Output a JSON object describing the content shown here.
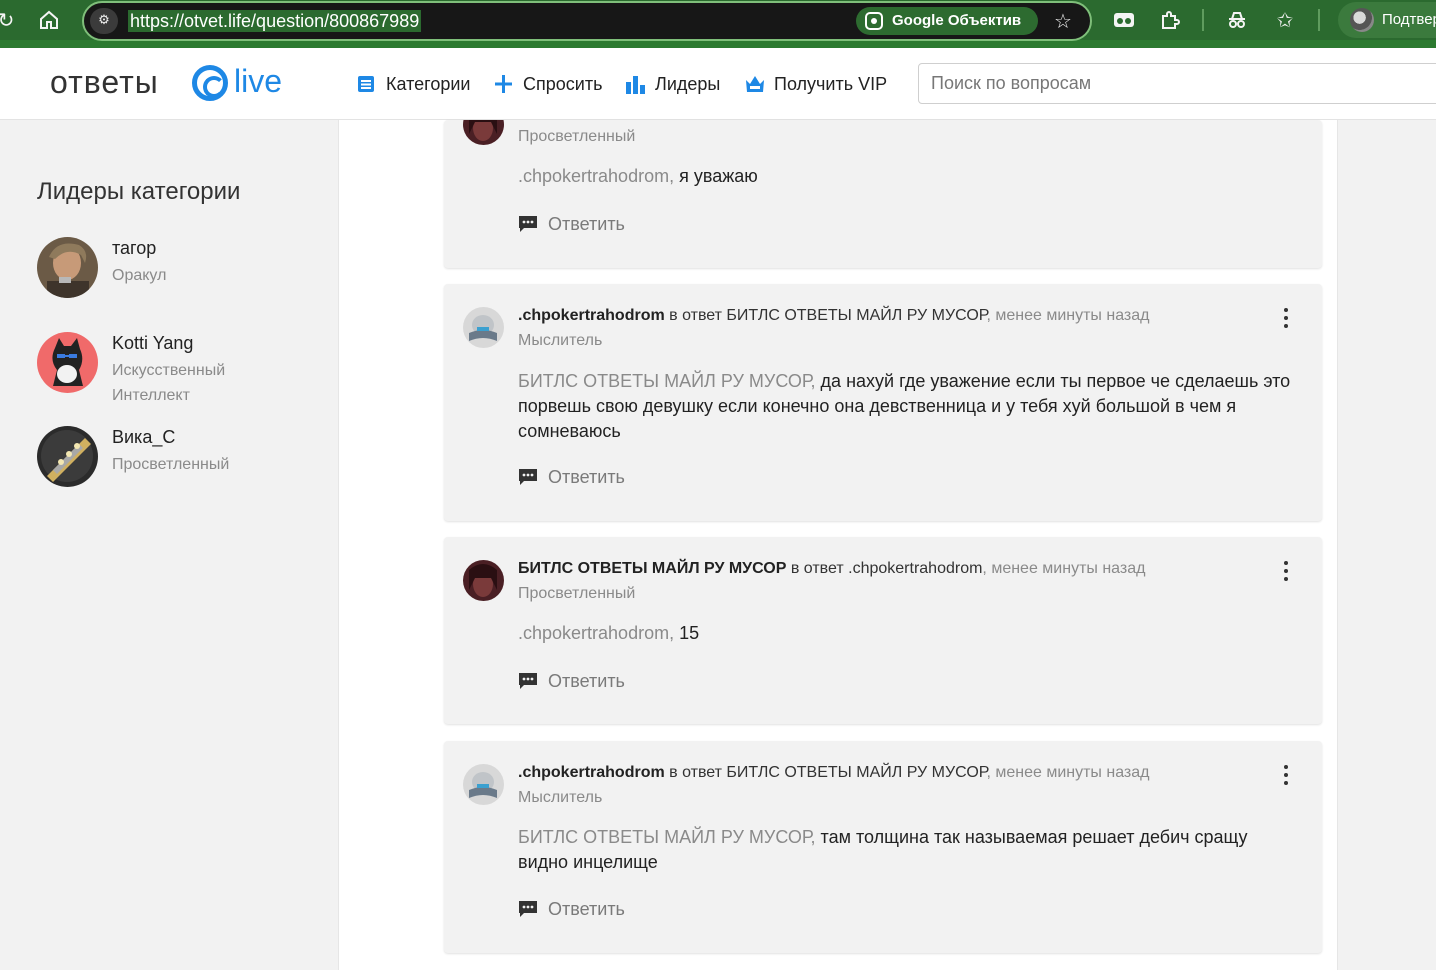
{
  "browser": {
    "url": "https://otvet.life/question/800867989",
    "lens_label": "Google Объектив",
    "profile_label": "Подтвердить"
  },
  "site": {
    "logo_left": "ответы",
    "logo_right": "live",
    "nav": {
      "categories": "Категории",
      "ask": "Спросить",
      "leaders": "Лидеры",
      "vip": "Получить VIP"
    },
    "search_placeholder": "Поиск по вопросам"
  },
  "sidebar": {
    "title": "Лидеры категории",
    "leaders": [
      {
        "name": "тагор",
        "rank": "Оракул"
      },
      {
        "name": "Kotti Yang",
        "rank": "Искусственный Интеллект"
      },
      {
        "name": "Вика_С",
        "rank": "Просветленный"
      }
    ]
  },
  "comments": [
    {
      "author": "",
      "rank": "Просветленный",
      "mention": ".chpokertrahodrom,",
      "text": " я уважаю",
      "reply_label": "Ответить"
    },
    {
      "author": ".chpokertrahodrom",
      "reply_to": " в ответ БИТЛС ОТВЕТЫ МАЙЛ РУ МУСОР",
      "time": ", менее минуты назад",
      "rank": "Мыслитель",
      "mention": "БИТЛС ОТВЕТЫ МАЙЛ РУ МУСОР,",
      "text": " да нахуй где уважение если ты первое че сделаешь это порвешь свою девушку если конечно она девственница и у тебя хуй большой в чем я сомневаюсь",
      "reply_label": "Ответить"
    },
    {
      "author": "БИТЛС ОТВЕТЫ МАЙЛ РУ МУСОР",
      "reply_to": " в ответ .chpokertrahodrom",
      "time": ", менее минуты назад",
      "rank": "Просветленный",
      "mention": ".chpokertrahodrom,",
      "text": " 15",
      "reply_label": "Ответить"
    },
    {
      "author": ".chpokertrahodrom",
      "reply_to": " в ответ БИТЛС ОТВЕТЫ МАЙЛ РУ МУСОР",
      "time": ", менее минуты назад",
      "rank": "Мыслитель",
      "mention": "БИТЛС ОТВЕТЫ МАЙЛ РУ МУСОР,",
      "text": " там толщина так называемая решает дебич сращу видно инцелище",
      "reply_label": "Ответить"
    }
  ],
  "colors": {
    "chrome_green": "#2b6a2f",
    "accent_blue": "#1e88e5",
    "muted_text": "#8a8a8a"
  },
  "icons": [
    "reload-icon",
    "home-icon",
    "site-settings-icon",
    "google-lens-icon",
    "bookmark-star-icon",
    "reading-mode-icon",
    "extensions-icon",
    "incognito-icon",
    "favorites-icon",
    "list-icon",
    "plus-icon",
    "bar-chart-icon",
    "crown-icon",
    "comment-icon",
    "more-vertical-icon"
  ]
}
